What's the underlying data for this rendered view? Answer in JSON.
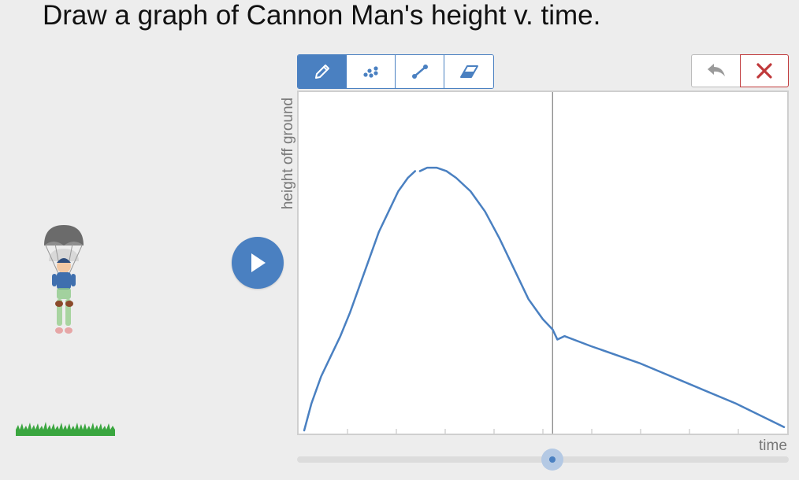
{
  "prompt": "Draw a graph of Cannon Man's height v. time.",
  "toolbar": {
    "tools": [
      {
        "name": "pencil",
        "icon": "pencil-icon",
        "active": true
      },
      {
        "name": "points",
        "icon": "scatter-points-icon",
        "active": false
      },
      {
        "name": "line",
        "icon": "line-segment-icon",
        "active": false
      },
      {
        "name": "eraser",
        "icon": "eraser-icon",
        "active": false
      }
    ],
    "undo_icon": "undo-arrow-icon",
    "clear_icon": "close-x-icon"
  },
  "graph": {
    "ylabel": "height off ground",
    "xlabel": "time",
    "time_marker": 0.52,
    "stroke_color": "#4a80c1"
  },
  "player": {
    "play_icon": "play-icon",
    "slider_value": 0.52
  },
  "colors": {
    "accent": "#4a80c1",
    "clear": "#c0393b",
    "grass": "#3aa63f"
  },
  "chart_data": {
    "type": "line",
    "xlabel": "time",
    "ylabel": "height off ground",
    "xlim": [
      0,
      1
    ],
    "ylim": [
      0,
      1
    ],
    "series": [
      {
        "x": [
          0.005,
          0.02,
          0.04,
          0.06,
          0.08,
          0.1,
          0.12,
          0.14,
          0.16,
          0.18,
          0.2,
          0.22,
          0.235
        ],
        "y": [
          0.0,
          0.08,
          0.16,
          0.22,
          0.28,
          0.35,
          0.43,
          0.51,
          0.59,
          0.65,
          0.71,
          0.75,
          0.77
        ]
      },
      {
        "x": [
          0.245,
          0.26,
          0.28,
          0.3,
          0.32,
          0.35,
          0.38,
          0.41,
          0.44,
          0.47,
          0.5,
          0.52,
          0.53,
          0.545
        ],
        "y": [
          0.77,
          0.78,
          0.78,
          0.77,
          0.75,
          0.71,
          0.65,
          0.57,
          0.48,
          0.39,
          0.33,
          0.3,
          0.27,
          0.28
        ]
      },
      {
        "x": [
          0.545,
          0.6,
          0.7,
          0.8,
          0.9,
          1.0
        ],
        "y": [
          0.28,
          0.25,
          0.2,
          0.14,
          0.08,
          0.01
        ]
      }
    ]
  }
}
